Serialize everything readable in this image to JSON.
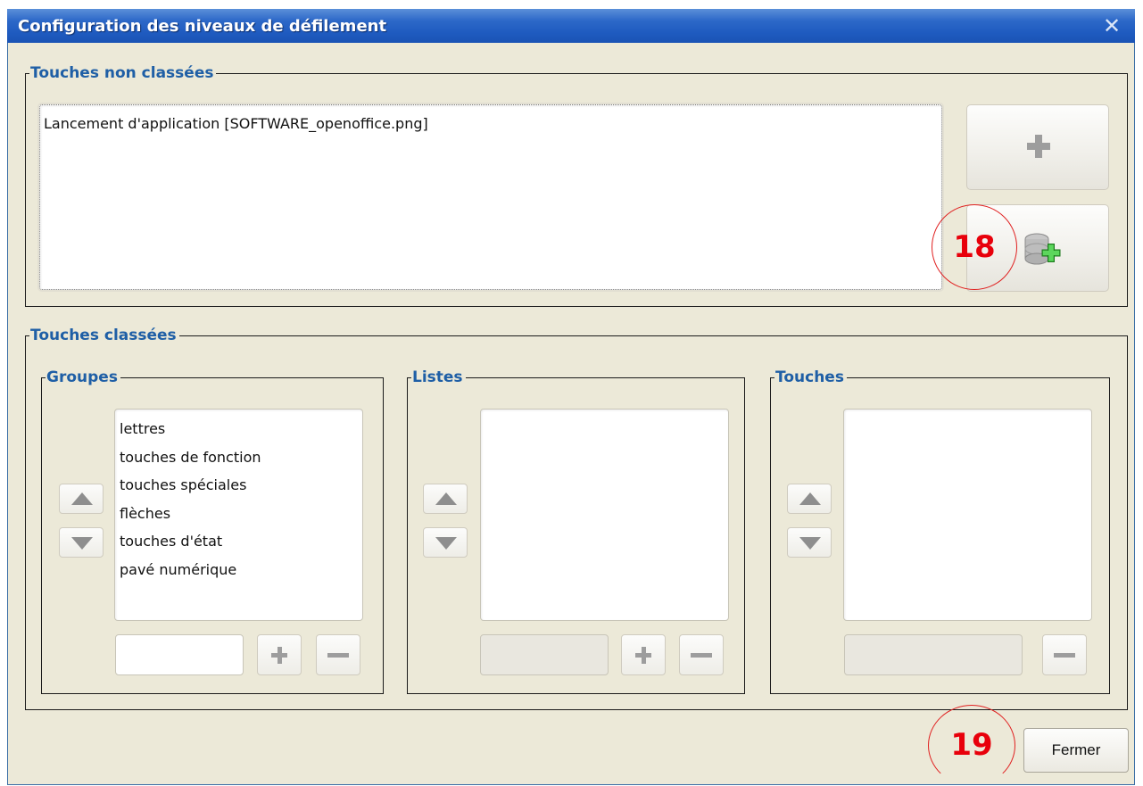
{
  "window": {
    "title": "Configuration des niveaux de défilement"
  },
  "unsorted": {
    "legend": "Touches non classées",
    "items": [
      "Lancement d'application [SOFTWARE_openoffice.png]"
    ]
  },
  "sorted": {
    "legend": "Touches classées",
    "groups": {
      "legend": "Groupes",
      "items": [
        "lettres",
        "touches de fonction",
        "touches spéciales",
        "flèches",
        "touches d'état",
        "pavé numérique"
      ]
    },
    "lists": {
      "legend": "Listes",
      "items": []
    },
    "keys": {
      "legend": "Touches",
      "items": []
    }
  },
  "annotations": {
    "first": "18",
    "second": "19"
  },
  "footer": {
    "close_label": "Fermer"
  },
  "colors": {
    "legend": "#1f5fa6",
    "annotation": "#e8000b",
    "titlebar": "#1f5bc0"
  }
}
